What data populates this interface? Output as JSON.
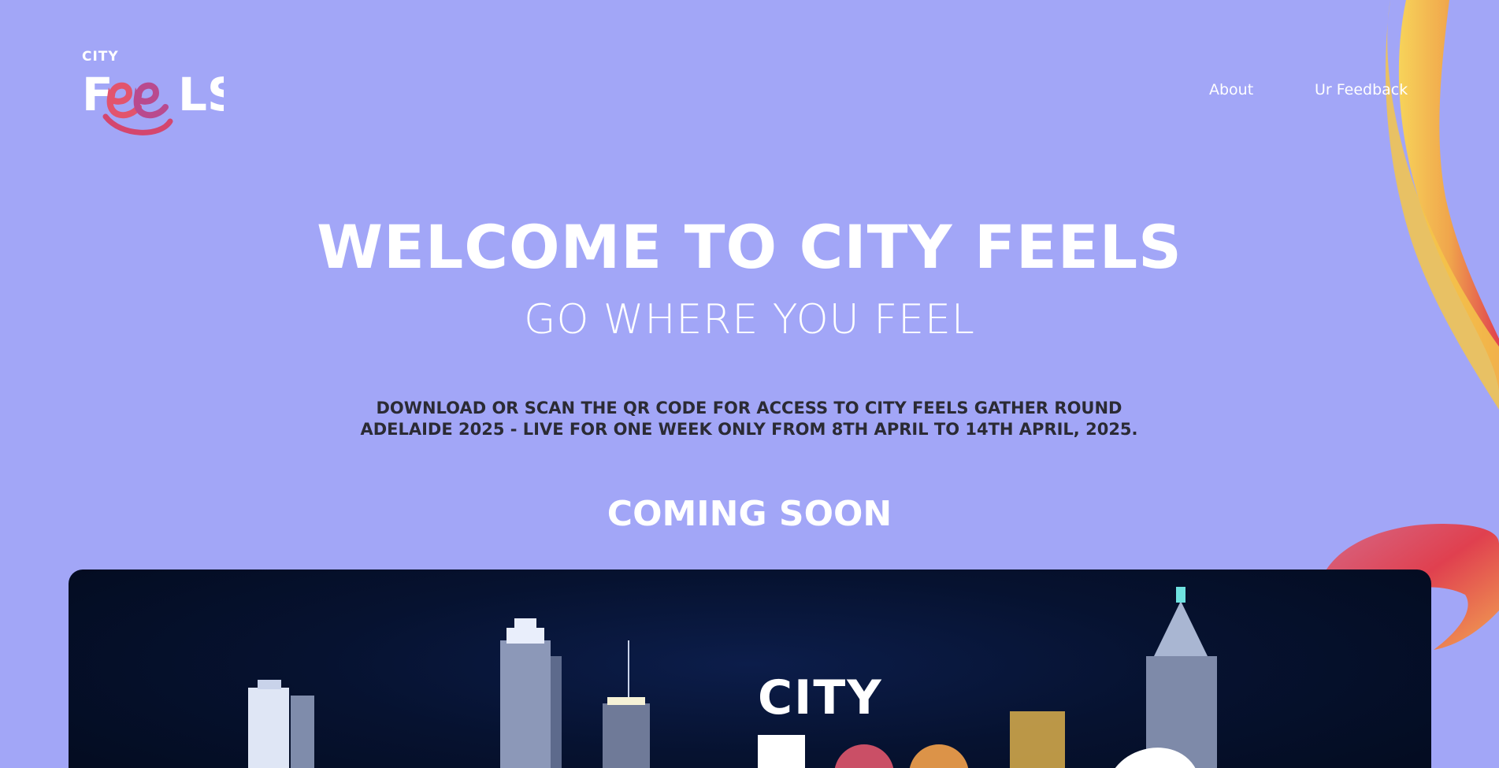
{
  "brand": {
    "logo_small": "CITY",
    "logo_large": "Feels",
    "colors": {
      "background": "#a2a6f7",
      "ribbon_yellow": "#f4c64a",
      "ribbon_red": "#e0404f",
      "banner_dark": "#030a1c"
    }
  },
  "nav": {
    "items": [
      {
        "label": "About"
      },
      {
        "label": "Ur Feedback"
      }
    ]
  },
  "hero": {
    "title": "WELCOME TO CITY FEELS",
    "subtitle": "GO WHERE YOU FEEL",
    "notice": "DOWNLOAD OR SCAN THE QR CODE FOR ACCESS TO CITY FEELS GATHER ROUND ADELAIDE 2025 - LIVE FOR ONE WEEK ONLY FROM 8TH APRIL TO 14TH APRIL, 2025.",
    "status": "COMING SOON"
  },
  "banner": {
    "logo_small": "CITY",
    "image": "city-skyline-night"
  }
}
